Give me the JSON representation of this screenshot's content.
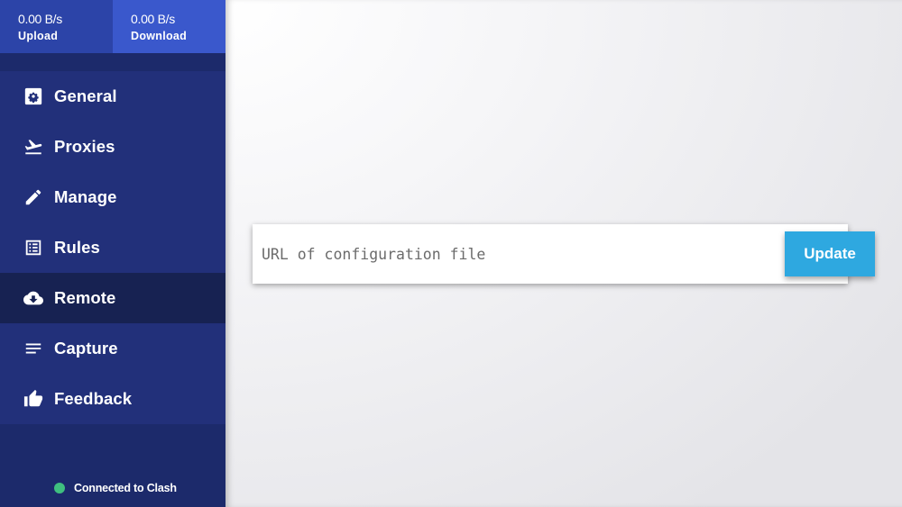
{
  "traffic": {
    "upload": {
      "rate": "0.00 B/s",
      "label": "Upload"
    },
    "download": {
      "rate": "0.00 B/s",
      "label": "Download"
    }
  },
  "nav": {
    "items": [
      {
        "label": "General",
        "icon": "gear-icon"
      },
      {
        "label": "Proxies",
        "icon": "plane-takeoff-icon"
      },
      {
        "label": "Manage",
        "icon": "pencil-icon"
      },
      {
        "label": "Rules",
        "icon": "list-icon"
      },
      {
        "label": "Remote",
        "icon": "cloud-download-icon",
        "active": true
      },
      {
        "label": "Capture",
        "icon": "lines-icon"
      },
      {
        "label": "Feedback",
        "icon": "thumbs-up-icon"
      }
    ]
  },
  "status": {
    "text": "Connected to Clash",
    "color": "#3fbf7f"
  },
  "remote": {
    "url_placeholder": "URL of configuration file",
    "url_value": "",
    "update_label": "Update"
  },
  "colors": {
    "sidebar": "#1c2a6b",
    "nav_bg": "#22307a",
    "active": "#172252",
    "upload_bg": "#2c44a8",
    "download_bg": "#3a58cc",
    "accent": "#2ea8e0"
  }
}
